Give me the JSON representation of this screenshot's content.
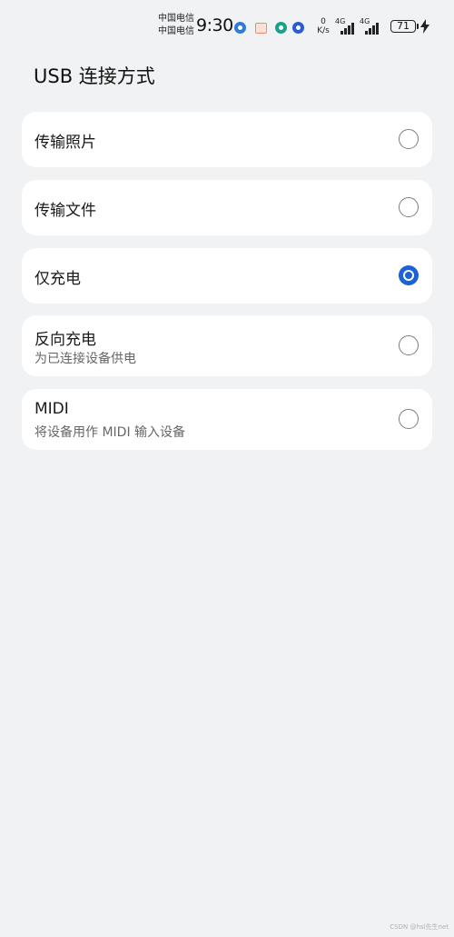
{
  "status_bar": {
    "carrier_1": "中国电信",
    "carrier_2": "中国电信",
    "time": "9:30",
    "net_speed_value": "0",
    "net_speed_unit": "K/s",
    "network_1": "4G",
    "network_2": "4G",
    "battery_level": "71",
    "icons": [
      "app-notification-icon",
      "mail-notification-icon",
      "security-notification-icon",
      "download-notification-icon"
    ]
  },
  "page": {
    "title": "USB 连接方式"
  },
  "options": [
    {
      "label": "传输照片",
      "subtitle": "",
      "selected": false
    },
    {
      "label": "传输文件",
      "subtitle": "",
      "selected": false
    },
    {
      "label": "仅充电",
      "subtitle": "",
      "selected": true
    },
    {
      "label": "反向充电",
      "subtitle": "为已连接设备供电",
      "selected": false
    },
    {
      "label": "MIDI",
      "subtitle": "将设备用作 MIDI 输入设备",
      "selected": false
    }
  ],
  "colors": {
    "background": "#f1f2f4",
    "card": "#ffffff",
    "accent": "#1a62d6"
  },
  "watermark": "CSDN @hsl先生net"
}
